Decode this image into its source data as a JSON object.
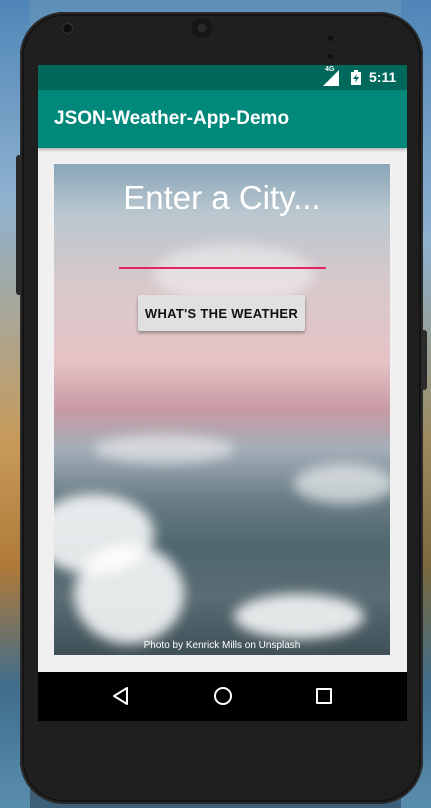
{
  "status_bar": {
    "network": "4G",
    "time": "5:11"
  },
  "app_bar": {
    "title": "JSON-Weather-App-Demo"
  },
  "main": {
    "city_hint": "Enter a City...",
    "weather_button_label": "WHAT'S THE WEATHER",
    "photo_credit": "Photo by Kenrick Mills on Unsplash"
  },
  "nav_bar": {
    "icons": [
      "back-icon",
      "home-icon",
      "recent-apps-icon"
    ]
  },
  "colors": {
    "status_bar": "#00695c",
    "app_bar": "#00897b",
    "accent_underline": "#e0245e",
    "button_bg": "#e0e0e0"
  }
}
